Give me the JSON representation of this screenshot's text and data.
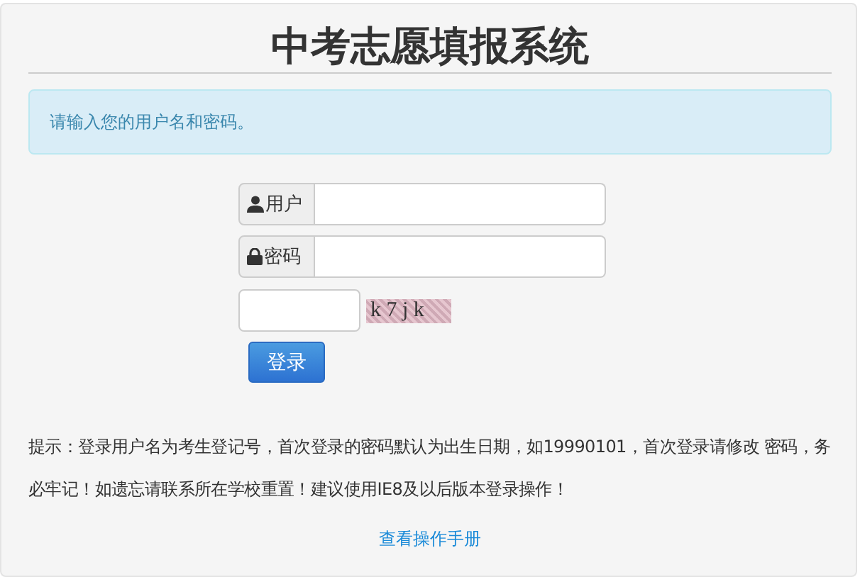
{
  "title": "中考志愿填报系统",
  "alert": "请输入您的用户名和密码。",
  "fields": [
    {
      "kind": "user",
      "label": "用户"
    },
    {
      "kind": "lock",
      "label": "密码"
    }
  ],
  "captcha": "k 7 j k",
  "login_button": "登录",
  "hint": "提示：登录用户名为考生登记号，首次登录的密码默认为出生日期，如19990101，首次登录请修改 密码，务必牢记！如遗忘请联系所在学校重置！建议使用IE8及以后版本登录操作！",
  "manual_link": "查看操作手册"
}
